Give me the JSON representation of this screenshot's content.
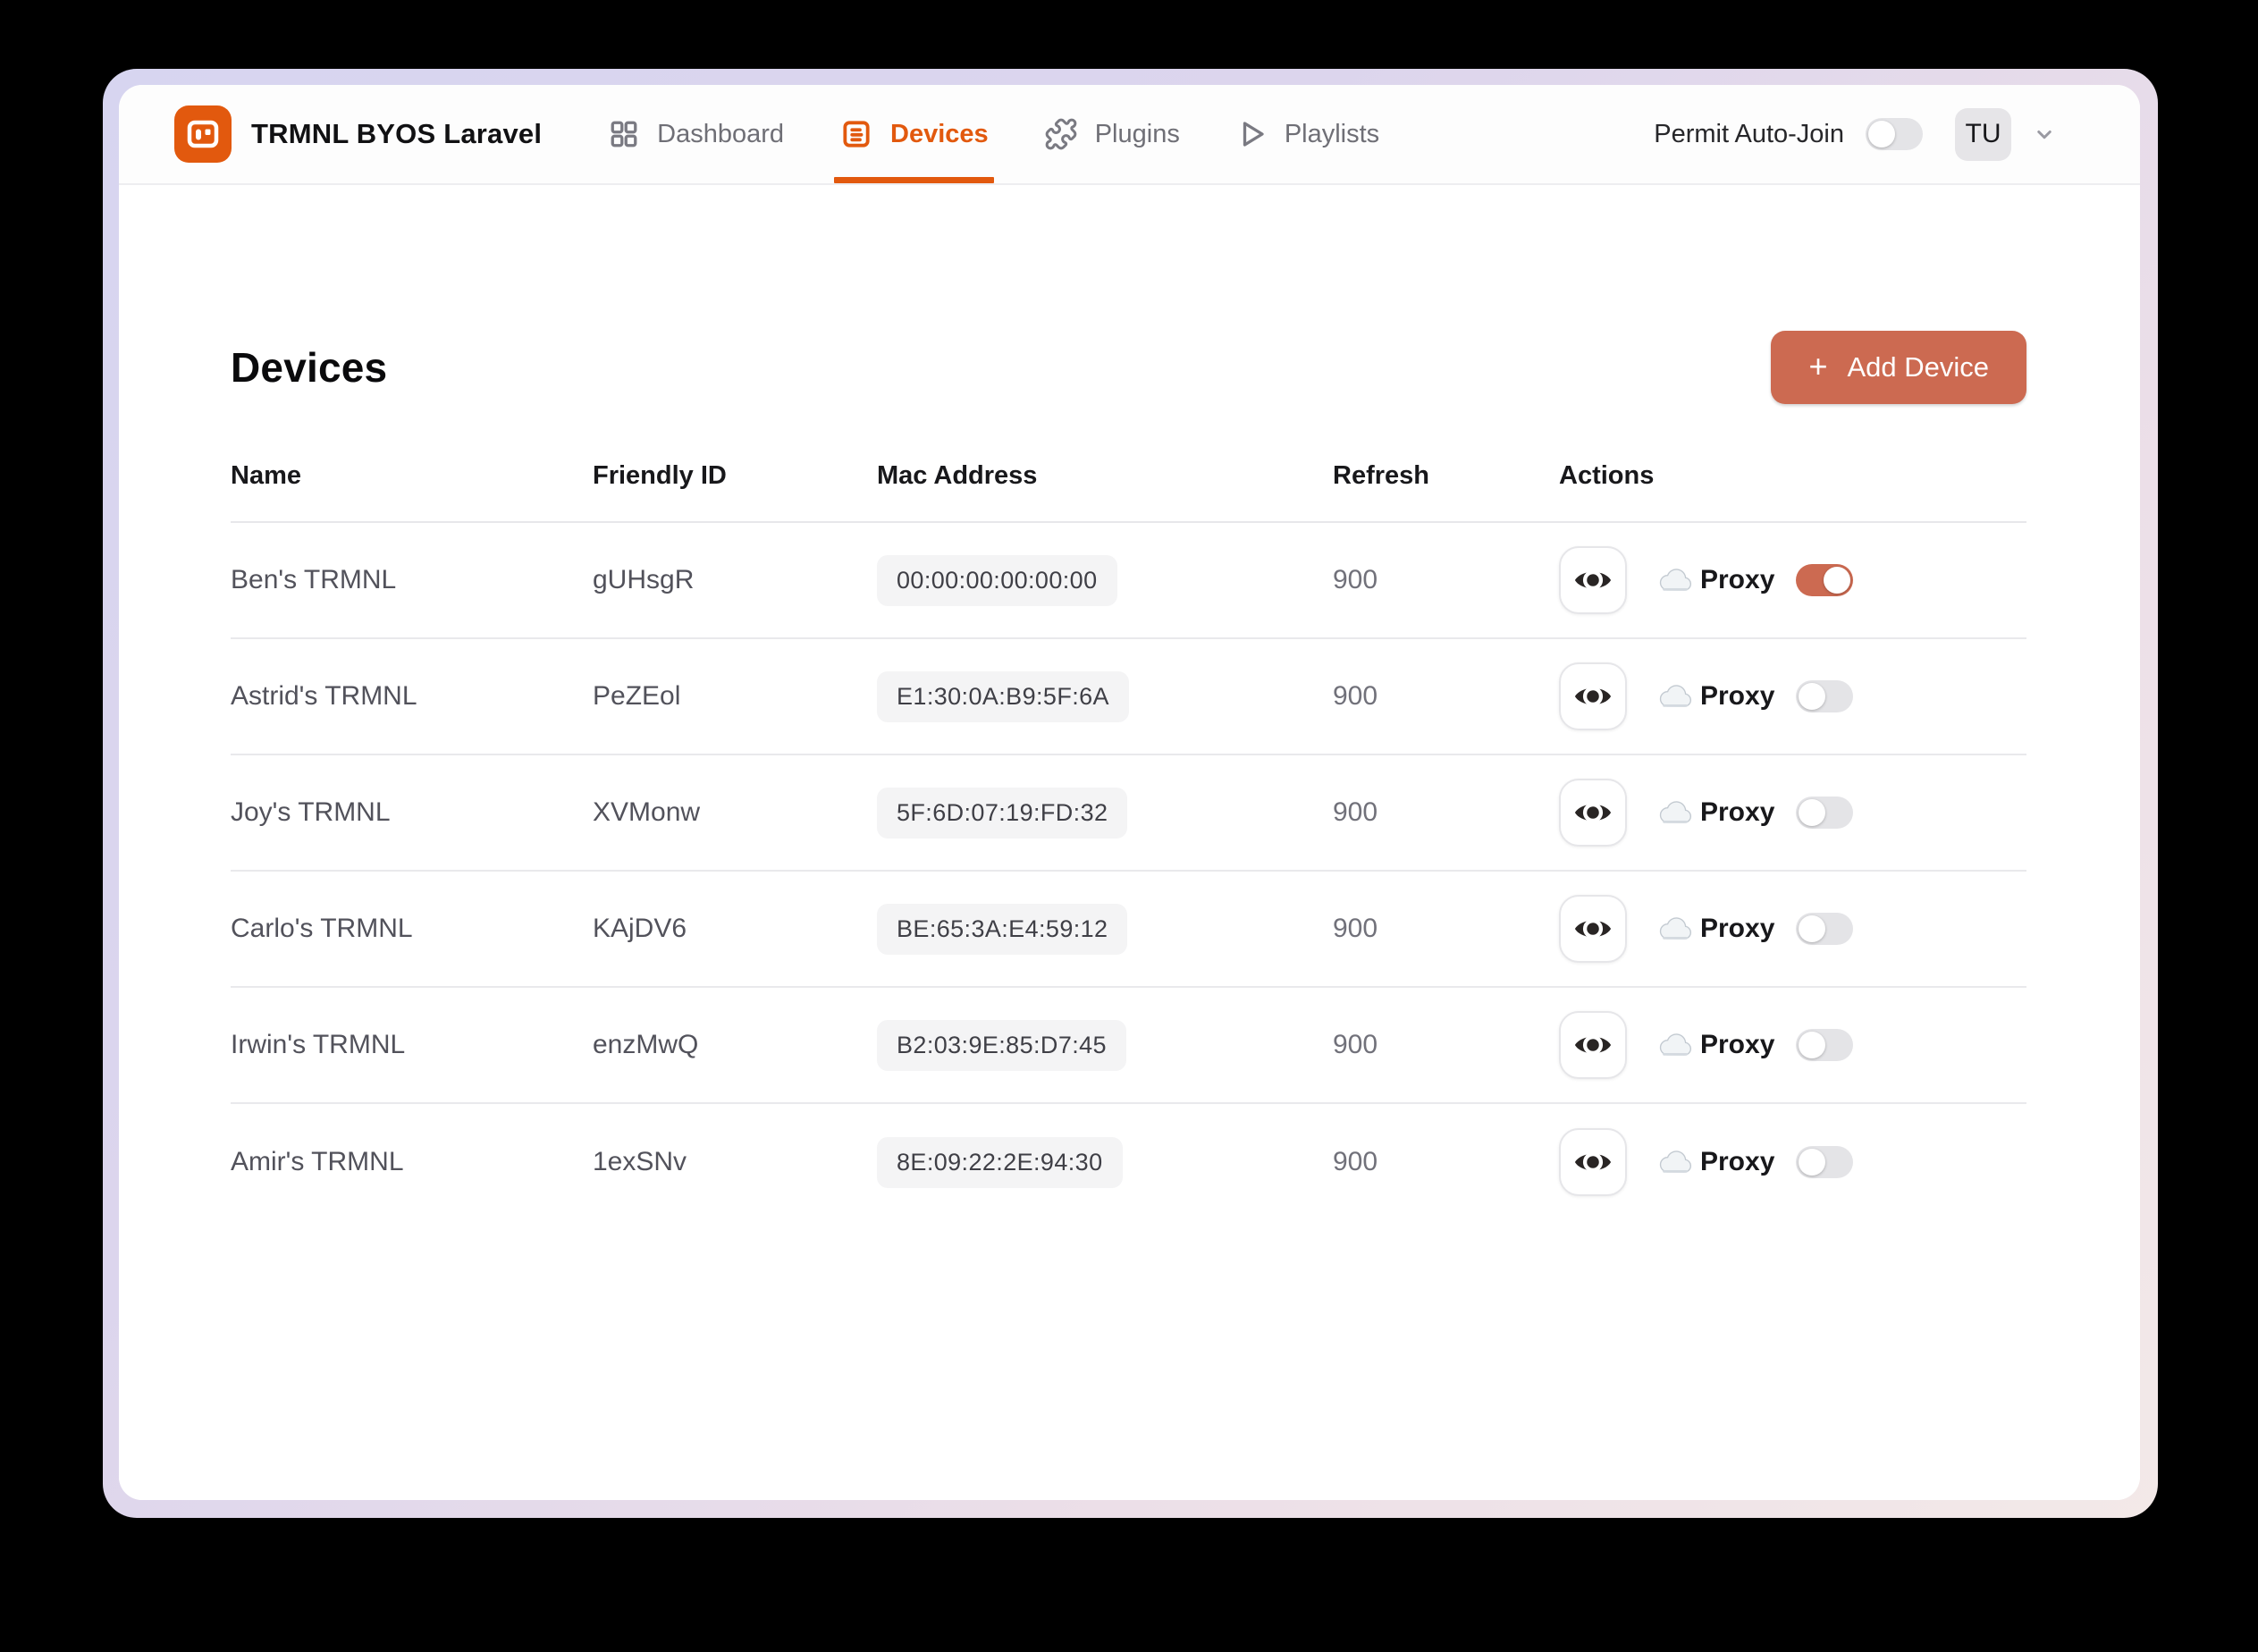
{
  "header": {
    "app_title": "TRMNL BYOS Laravel",
    "nav": [
      {
        "label": "Dashboard",
        "icon": "grid-icon",
        "active": false
      },
      {
        "label": "Devices",
        "icon": "device-list-icon",
        "active": true
      },
      {
        "label": "Plugins",
        "icon": "puzzle-icon",
        "active": false
      },
      {
        "label": "Playlists",
        "icon": "play-icon",
        "active": false
      }
    ],
    "permit_auto_join": {
      "label": "Permit Auto-Join",
      "enabled": false
    },
    "avatar_initials": "TU"
  },
  "page": {
    "title": "Devices",
    "add_device_label": "Add Device",
    "plus_symbol": "+"
  },
  "table": {
    "columns": [
      "Name",
      "Friendly ID",
      "Mac Address",
      "Refresh",
      "Actions"
    ],
    "proxy_label": "Proxy",
    "rows": [
      {
        "name": "Ben's TRMNL",
        "friendly_id": "gUHsgR",
        "mac": "00:00:00:00:00:00",
        "refresh": "900",
        "proxy_on": true
      },
      {
        "name": "Astrid's TRMNL",
        "friendly_id": "PeZEol",
        "mac": "E1:30:0A:B9:5F:6A",
        "refresh": "900",
        "proxy_on": false
      },
      {
        "name": "Joy's TRMNL",
        "friendly_id": "XVMonw",
        "mac": "5F:6D:07:19:FD:32",
        "refresh": "900",
        "proxy_on": false
      },
      {
        "name": "Carlo's TRMNL",
        "friendly_id": "KAjDV6",
        "mac": "BE:65:3A:E4:59:12",
        "refresh": "900",
        "proxy_on": false
      },
      {
        "name": "Irwin's TRMNL",
        "friendly_id": "enzMwQ",
        "mac": "B2:03:9E:85:D7:45",
        "refresh": "900",
        "proxy_on": false
      },
      {
        "name": "Amir's TRMNL",
        "friendly_id": "1exSNv",
        "mac": "8E:09:22:2E:94:30",
        "refresh": "900",
        "proxy_on": false
      }
    ]
  },
  "colors": {
    "accent_orange": "#e2590e",
    "terracotta": "#cc6a51",
    "toggle_off": "#e4e4e7",
    "pill_bg": "#f4f4f5"
  }
}
